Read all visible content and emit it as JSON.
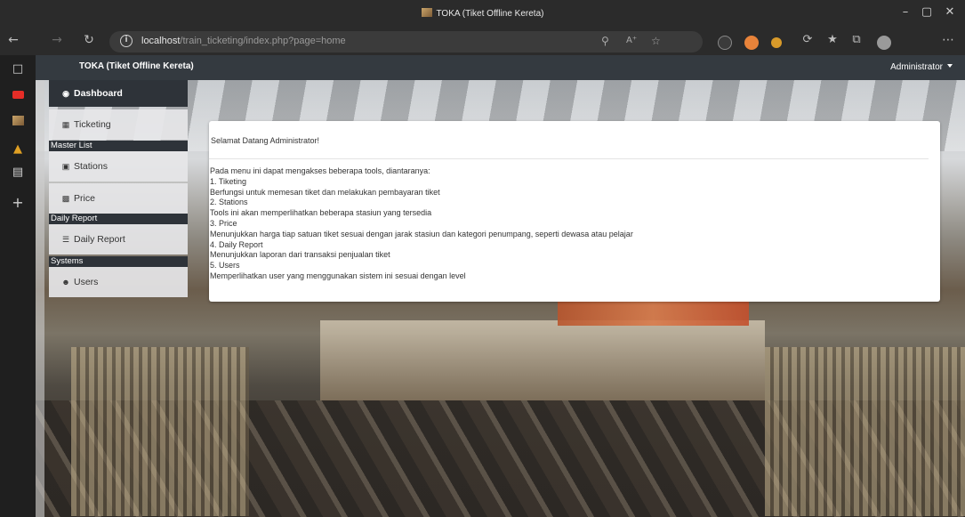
{
  "window": {
    "title": "TOKA (Tiket Offline Kereta)",
    "controls": {
      "minimize": "–",
      "maximize": "▢",
      "close": "✕"
    }
  },
  "browser": {
    "url_host": "localhost",
    "url_path": "/train_ticketing/index.php?page=home",
    "icons": [
      "back-icon",
      "forward-icon",
      "refresh-icon",
      "info-icon",
      "key-icon",
      "read-aloud-icon",
      "favorite-add-icon",
      "extension-icon",
      "privacy-icon",
      "badge-icon",
      "sync-icon",
      "favorites-icon",
      "collections-icon",
      "profile-icon",
      "more-icon"
    ]
  },
  "app": {
    "brand": "TOKA (Tiket Offline Kereta)",
    "user": "Administrator"
  },
  "menu": {
    "dashboard": "Dashboard",
    "ticketing": "Ticketing",
    "master_list": "Master List",
    "stations": "Stations",
    "price": "Price",
    "daily_report_head": "Daily Report",
    "daily_report": "Daily Report",
    "systems": "Systems",
    "users": "Users"
  },
  "card": {
    "greeting": "Selamat Datang Administrator!",
    "lines": [
      "Pada menu ini dapat mengakses beberapa tools, diantaranya:",
      "1. Tiketing",
      "Berfungsi untuk memesan tiket dan melakukan pembayaran tiket",
      "2. Stations",
      "Tools ini akan memperlihatkan beberapa stasiun yang tersedia",
      "3. Price",
      "Menunjukkan harga tiap satuan tiket sesuai dengan jarak stasiun dan kategori penumpang, seperti dewasa atau pelajar",
      "4. Daily Report",
      "Menunjukkan laporan dari transaksi penjualan tiket",
      "5. Users",
      "Memperlihatkan user yang menggunakan sistem ini sesuai dengan level"
    ]
  },
  "colors": {
    "navbar": "#343a40",
    "chrome": "#2b2b2b",
    "menu_active": "#2e3339"
  }
}
